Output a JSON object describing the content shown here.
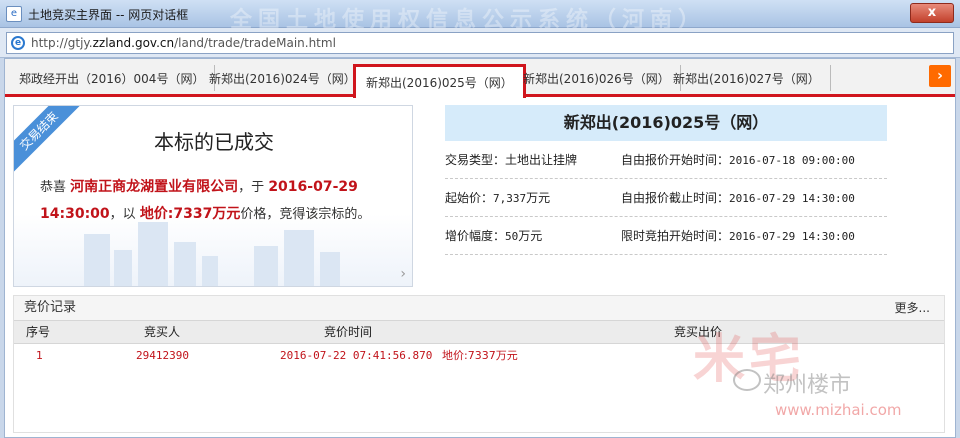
{
  "window": {
    "title": "土地竞买主界面 -- 网页对话框",
    "bg_banner": "全国土地使用权信息公示系统（河南）",
    "close_label": "x",
    "url_prefix": "http://gtjy.",
    "url_domain": "zzland.gov.cn",
    "url_path": "/land/trade/tradeMain.html"
  },
  "tabs": [
    {
      "label": "郑政经开出（2016）004号（网）"
    },
    {
      "label": "新郑出(2016)024号（网）"
    },
    {
      "label": "新郑出(2016)025号（网）",
      "active": true
    },
    {
      "label": "新郑出(2016)026号（网）"
    },
    {
      "label": "新郑出(2016)027号（网）"
    }
  ],
  "tab_next_label": "›",
  "result": {
    "ribbon": "交易结束",
    "title": "本标的已成交",
    "congrats": "恭喜",
    "buyer": "河南正商龙湖置业有限公司",
    "sep1": "，于",
    "time": "2016-07-29 14:30:00",
    "sep2": "，以",
    "price": "地价:7337万元",
    "suffix": "价格，竞得该宗标的。"
  },
  "info": {
    "heading": "新郑出(2016)025号（网）",
    "rows": [
      {
        "left": "交易类型：土地出让挂牌",
        "right_label": "自由报价开始时间：",
        "right_value": "2016-07-18 09:00:00"
      },
      {
        "left_label": "起始价：",
        "left_value": "7,337",
        "left_unit": "万元",
        "right_label": "自由报价截止时间：",
        "right_value": "2016-07-29 14:30:00"
      },
      {
        "left_label": "增价幅度：",
        "left_value": "50",
        "left_unit": "万元",
        "right_label": "限时竞拍开始时间：",
        "right_value": "2016-07-29 14:30:00"
      }
    ]
  },
  "bids": {
    "heading": "竞价记录",
    "more": "更多...",
    "columns": [
      "序号",
      "竞买人",
      "竞价时间",
      "竞买出价"
    ],
    "rows": [
      {
        "no": "1",
        "bidder": "29412390",
        "time": "2016-07-22 07:41:56.870",
        "price": "地价:7337万元"
      }
    ]
  },
  "watermark": {
    "big": "米宅",
    "name": "郑州楼市",
    "site": "www.mizhai.com"
  }
}
